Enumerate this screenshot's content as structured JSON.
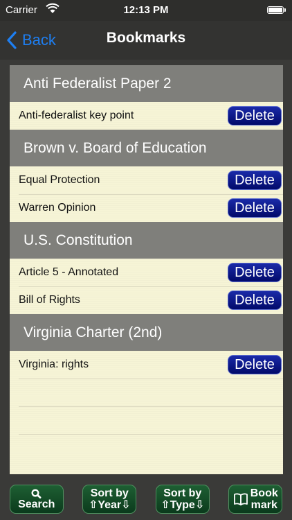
{
  "status_bar": {
    "carrier": "Carrier",
    "time": "12:13 PM"
  },
  "nav": {
    "back_label": "Back",
    "title": "Bookmarks"
  },
  "sections": [
    {
      "title": "Anti Federalist Paper 2",
      "items": [
        {
          "label": "Anti-federalist key point",
          "action": "Delete"
        }
      ]
    },
    {
      "title": "Brown v. Board of Education",
      "items": [
        {
          "label": "Equal Protection",
          "action": "Delete"
        },
        {
          "label": "Warren Opinion",
          "action": "Delete"
        }
      ]
    },
    {
      "title": "U.S. Constitution",
      "items": [
        {
          "label": "Article 5 - Annotated",
          "action": "Delete"
        },
        {
          "label": "Bill of Rights",
          "action": "Delete"
        }
      ]
    },
    {
      "title": "Virginia Charter (2nd)",
      "items": [
        {
          "label": "Virginia:  rights",
          "action": "Delete"
        }
      ]
    }
  ],
  "toolbar": {
    "search": "Search",
    "sort_year_line1": "Sort by",
    "sort_year_line2": "⇧Year⇩",
    "sort_type_line1": "Sort by",
    "sort_type_line2": "⇧Type⇩",
    "bookmark_line1": "Book",
    "bookmark_line2": "mark"
  },
  "colors": {
    "accent": "#1e7ff2",
    "section_header": "#7f7f7b",
    "content_bg": "#f6f4d6",
    "delete_button": "#0a1890",
    "toolbar_button": "#154a28"
  },
  "icons": {
    "back": "chevron-left-icon",
    "search": "magnifier-icon",
    "bookmark": "open-book-icon",
    "wifi": "wifi-icon",
    "battery": "battery-icon"
  }
}
